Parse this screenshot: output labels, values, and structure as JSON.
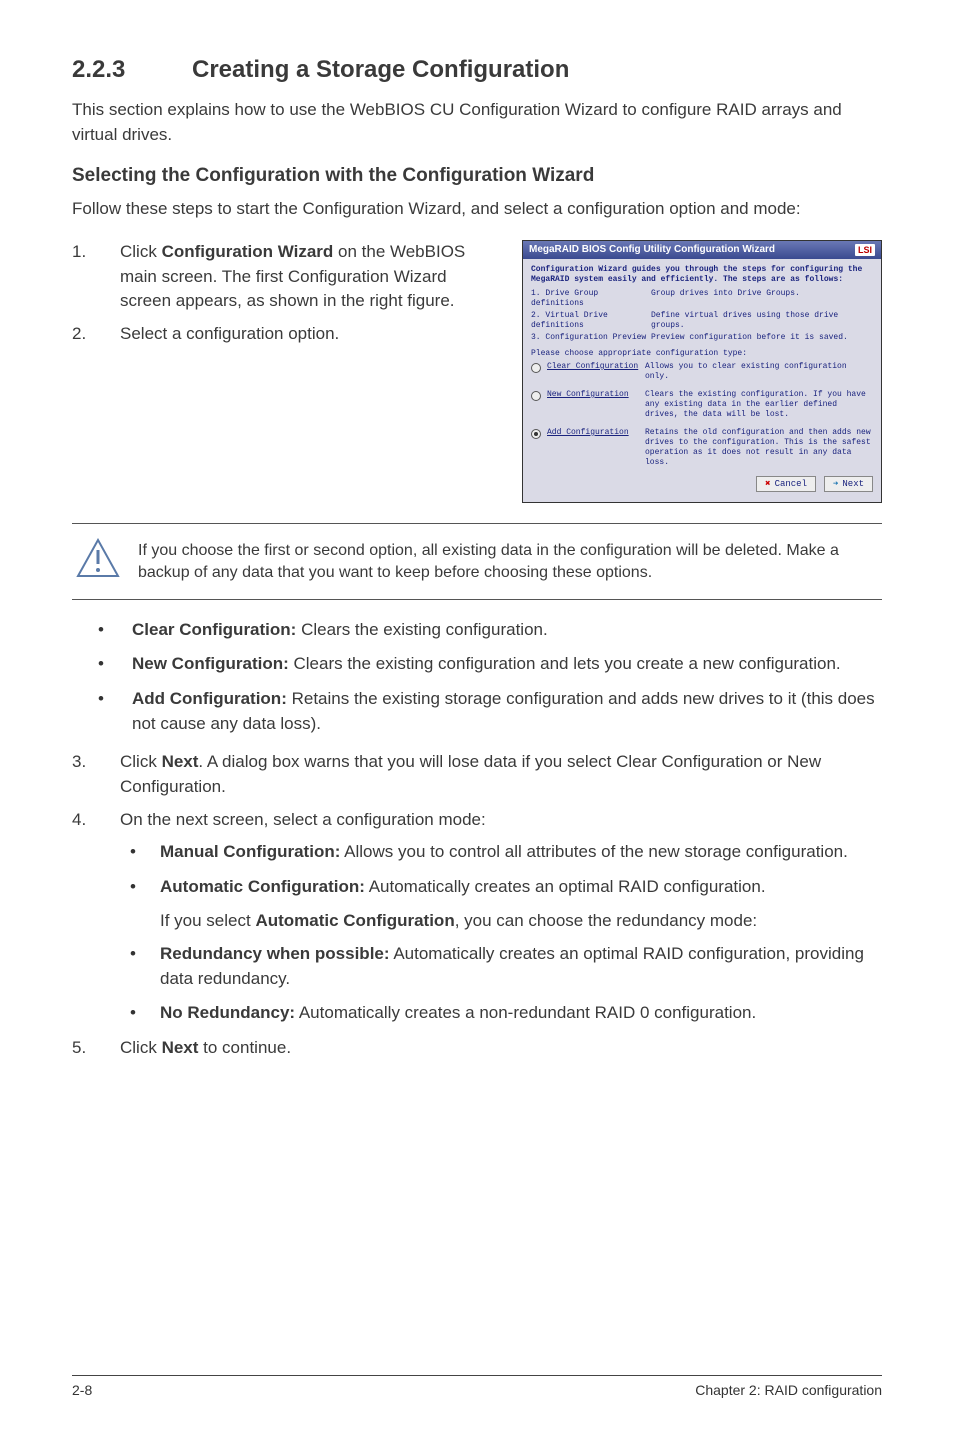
{
  "section": {
    "number": "2.2.3",
    "title": "Creating a Storage Configuration"
  },
  "intro": "This section explains how to use the WebBIOS CU Configuration Wizard to configure RAID arrays and virtual drives.",
  "subhead": "Selecting the Configuration with the Configuration Wizard",
  "sub_intro": "Follow these steps to start the Configuration Wizard, and select a configuration option and mode:",
  "step1": {
    "n": "1.",
    "pre": "Click ",
    "bold": "Configuration Wizard",
    "post": " on the WebBIOS main screen. The first Configuration Wizard screen appears, as shown in the right figure."
  },
  "step2": {
    "n": "2.",
    "text": "Select a configuration option."
  },
  "wizard": {
    "titlebar": "MegaRAID BIOS Config Utility Configuration Wizard",
    "logo": "LSI",
    "intro": "Configuration Wizard guides you through the steps for configuring the MegaRAID system easily and efficiently. The steps are as follows:",
    "line1_l": "1. Drive Group definitions",
    "line1_r": "Group drives into Drive Groups.",
    "line2_l": "2. Virtual Drive definitions",
    "line2_r": "Define virtual drives using those drive groups.",
    "line3_l": "3. Configuration Preview",
    "line3_r": "Preview configuration before it is saved.",
    "choose": "Please choose appropriate configuration type:",
    "opt1_lbl": "Clear Configuration",
    "opt1_desc": "Allows you to clear existing configuration only.",
    "opt2_lbl": "New Configuration",
    "opt2_desc": "Clears the existing configuration. If you have any existing data in the earlier defined drives, the data will be lost.",
    "opt3_lbl": "Add Configuration",
    "opt3_desc": "Retains the old configuration and then adds new drives to the configuration. This is the safest operation as it does not result in any data loss.",
    "btn_cancel": "Cancel",
    "btn_next": "Next"
  },
  "note": "If you choose the first or second option, all existing data in the configuration will be deleted. Make a backup of any data that you want to keep before choosing these options.",
  "bullet1": {
    "bold": "Clear Configuration:",
    "rest": " Clears the existing configuration."
  },
  "bullet2": {
    "bold": "New Configuration:",
    "rest": " Clears the existing configuration and lets you create a new configuration."
  },
  "bullet3": {
    "bold": "Add Configuration:",
    "rest": " Retains the existing storage configuration and adds new drives to it (this does not cause any data loss)."
  },
  "step3": {
    "n": "3.",
    "pre": "Click ",
    "bold": "Next",
    "post": ". A dialog box warns that you will lose data if you select Clear Configuration or New Configuration."
  },
  "step4": {
    "n": "4.",
    "text": "On the next screen, select a configuration mode:"
  },
  "sb1": {
    "bold": "Manual Configuration:",
    "rest": " Allows you to control all attributes of the new storage configuration."
  },
  "sb2": {
    "bold": "Automatic Configuration:",
    "rest": " Automatically creates an optimal RAID configuration."
  },
  "auto_line": {
    "pre": "If you select ",
    "bold": "Automatic Configuration",
    "post": ", you can choose the redundancy mode:"
  },
  "sb3": {
    "bold": "Redundancy when possible:",
    "rest": " Automatically creates an optimal RAID configuration, providing data redundancy."
  },
  "sb4": {
    "bold": "No Redundancy:",
    "rest": " Automatically creates a non-redundant RAID 0 configuration."
  },
  "step5": {
    "n": "5.",
    "pre": "Click ",
    "bold": "Next",
    "post": " to continue."
  },
  "footer": {
    "left": "2-8",
    "right": "Chapter 2: RAID configuration"
  }
}
